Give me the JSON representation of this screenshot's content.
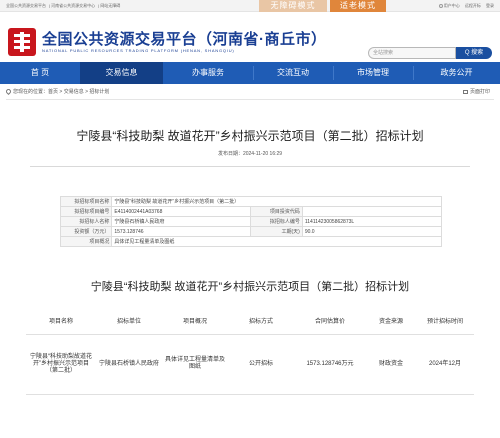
{
  "topbar": {
    "links": [
      "全国公共资源交易平台",
      "河南省公共资源交易中心",
      "网站无障碍"
    ],
    "mode_accessible": "无障碍模式",
    "mode_elderly": "适老模式",
    "user_center": "用户中心",
    "remote_bid": "远程开标",
    "login": "登录"
  },
  "header": {
    "site_title": "全国公共资源交易平台（河南省·商丘市）",
    "site_subtitle": "NATIONAL PUBLIC RESOURCES TRADING PLATFORM (HENAN, SHANGQIU)",
    "search_placeholder": "全站搜索",
    "search_button": "Q 搜索"
  },
  "nav": {
    "items": [
      "首 页",
      "交易信息",
      "办事服务",
      "交流互动",
      "市场管理",
      "政务公开"
    ],
    "active_index": 1
  },
  "breadcrumb": {
    "text": "您现在的位置：首页 > 交易信息 > 招标计划",
    "print": "页面打印"
  },
  "article": {
    "title": "宁陵县“科技助梨 故道花开”乡村振兴示范项目（第二批）招标计划",
    "date": "发布日期：2024-11-20 16:29"
  },
  "info": {
    "project_name_label": "拟招标项目名称",
    "project_name": "宁陵县“科技助梨 故道花开”乡村振兴示范项目（第二批）",
    "project_code_label": "拟招标项目编号",
    "project_code": "E4114002441A03768",
    "invest_code_label": "项目投资代码",
    "invest_code": "",
    "tenderer_label": "拟招标人名称",
    "tenderer": "宁陵县石桥镇人民政府",
    "tenderer_code_label": "拟招标人编号",
    "tenderer_code": "11411423005862873L",
    "investment_label": "投资额（万元）",
    "investment": "1573.128746",
    "duration_label": "工期(天)",
    "duration": "90.0",
    "overview_label": "项目概况",
    "overview": "具体详见工程量清单及图纸"
  },
  "plan": {
    "title": "宁陵县“科技助梨 故道花开”乡村振兴示范项目（第二批）招标计划",
    "headers": [
      "项目名称",
      "招标单位",
      "项目概况",
      "招标方式",
      "合同估算价",
      "资金来源",
      "预计招标时间"
    ],
    "row": [
      "宁陵县“科技助梨故道花开”乡村振兴示范项目（第二批）",
      "宁陵县石桥镇人民政府",
      "具体详见工程量清单及图纸",
      "公开招标",
      "1573.128746万元",
      "财政资金",
      "2024年12月"
    ]
  }
}
